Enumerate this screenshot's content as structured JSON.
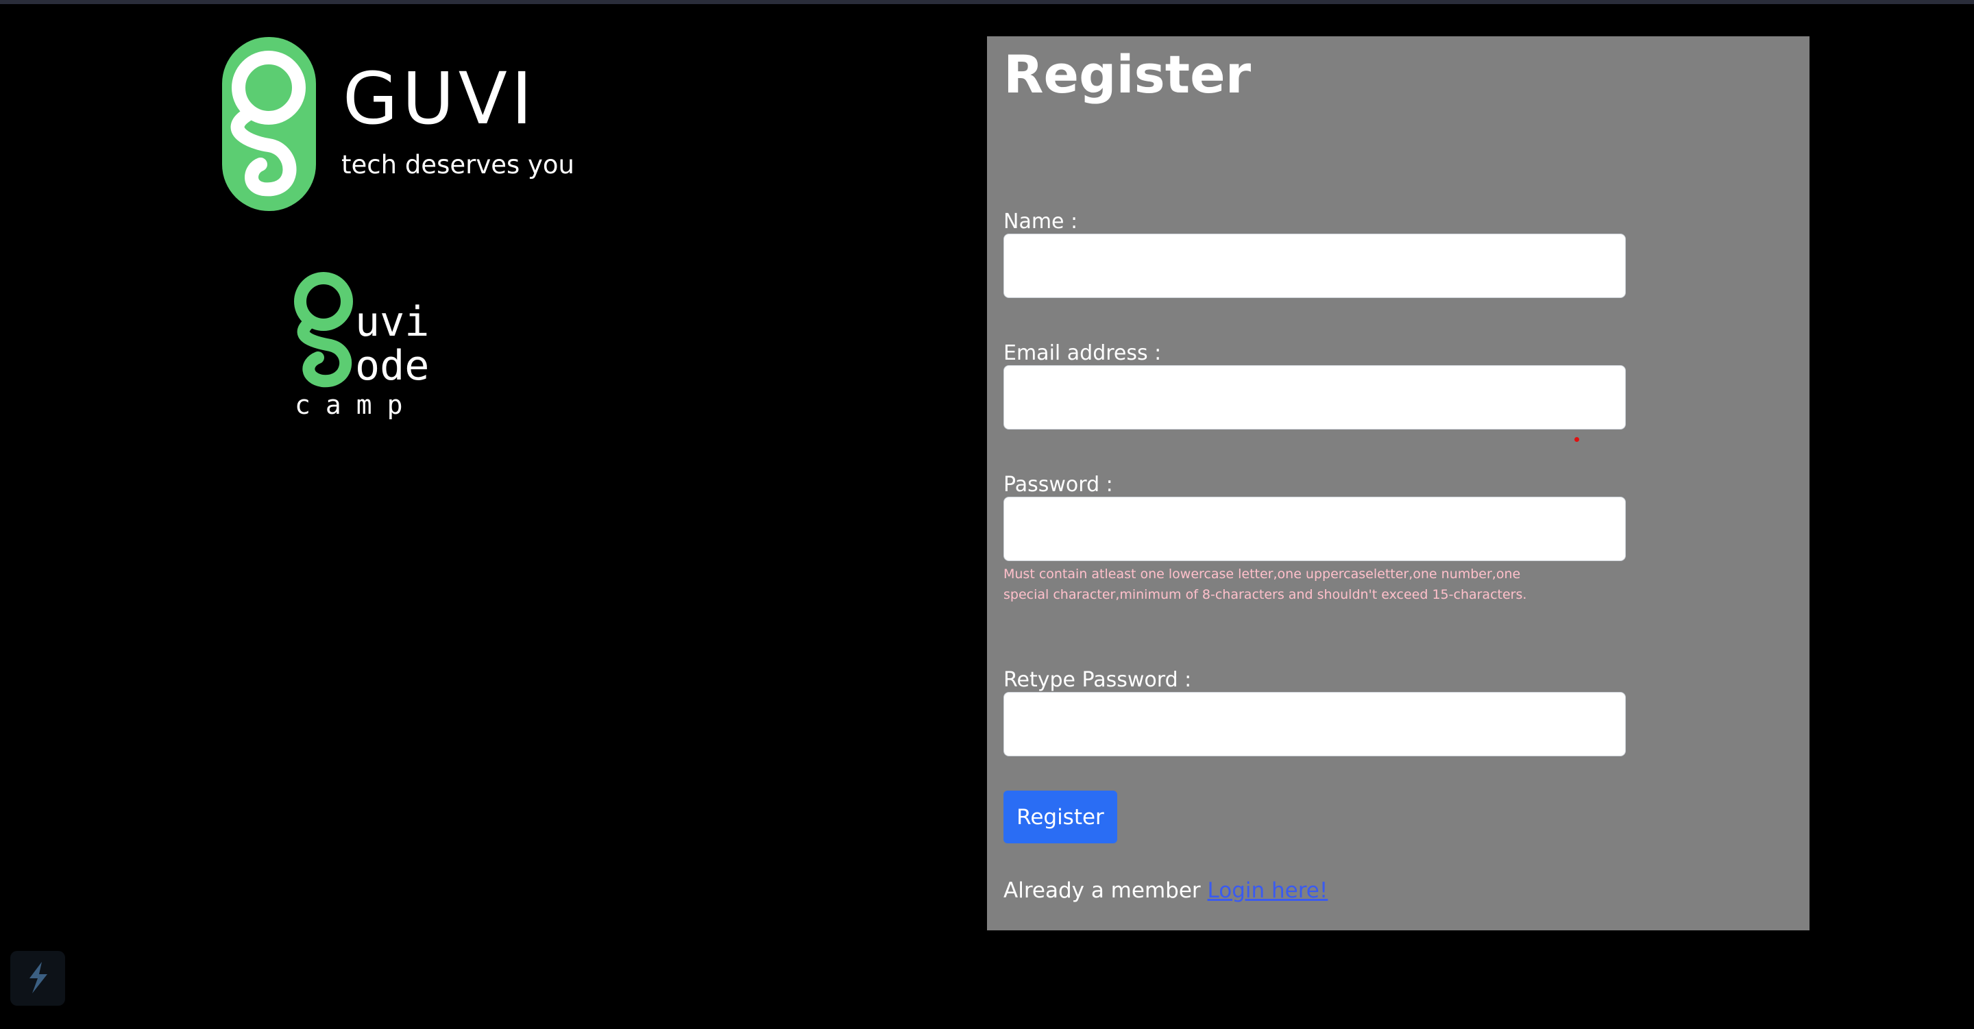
{
  "brand": {
    "name": "GUVI",
    "tagline": "tech deserves you",
    "accent_color": "#5ccd72"
  },
  "codecamp": {
    "line1": "uvi",
    "line2": "ode",
    "line3": "camp"
  },
  "form": {
    "title": "Register",
    "name_label": "Name :",
    "name_value": "",
    "email_label": "Email address :",
    "email_value": "",
    "password_label": "Password :",
    "password_value": "",
    "password_hint": "Must contain atleast one lowercase letter,one uppercaseletter,one number,one special character,minimum of 8-characters and shouldn't exceed 15-characters.",
    "retype_label": "Retype Password :",
    "retype_value": "",
    "submit_label": "Register",
    "member_text": "Already a member",
    "login_link": "Login here!"
  },
  "widget": {
    "icon": "lightning-icon"
  },
  "colors": {
    "page_bg": "#000000",
    "panel_bg": "#808080",
    "button_bg": "#2a6df4",
    "hint_text": "#ffc0cb",
    "link": "#3a5bf0"
  }
}
